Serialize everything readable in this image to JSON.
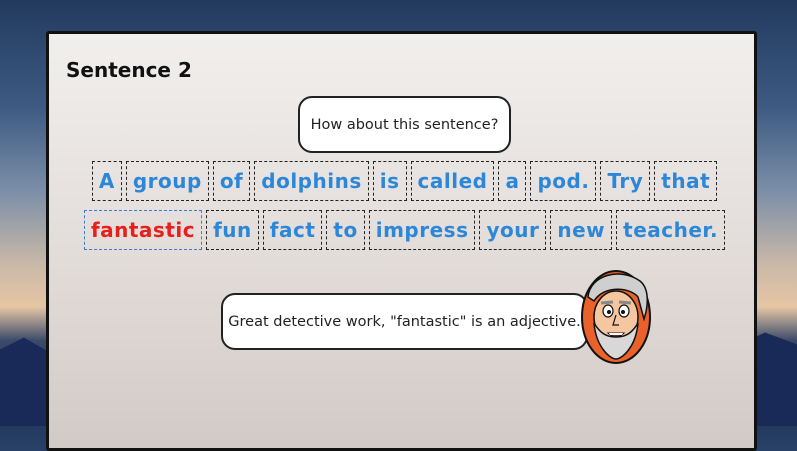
{
  "section": {
    "title": "Sentence 2"
  },
  "prompt": {
    "text": "How about this sentence?"
  },
  "sentence": {
    "row1": [
      "A",
      "group",
      "of",
      "dolphins",
      "is",
      "called",
      "a",
      "pod.",
      "Try",
      "that"
    ],
    "row2": [
      "fantastic",
      "fun",
      "fact",
      "to",
      "impress",
      "your",
      "new",
      "teacher."
    ],
    "selected_word": "fantastic"
  },
  "feedback": {
    "text": "Great detective work, \"fantastic\" is an adjective."
  },
  "colors": {
    "word": "#2d87d8",
    "selected": "#e8201c"
  },
  "icons": {
    "avatar": "bearded-teacher-avatar-icon"
  }
}
